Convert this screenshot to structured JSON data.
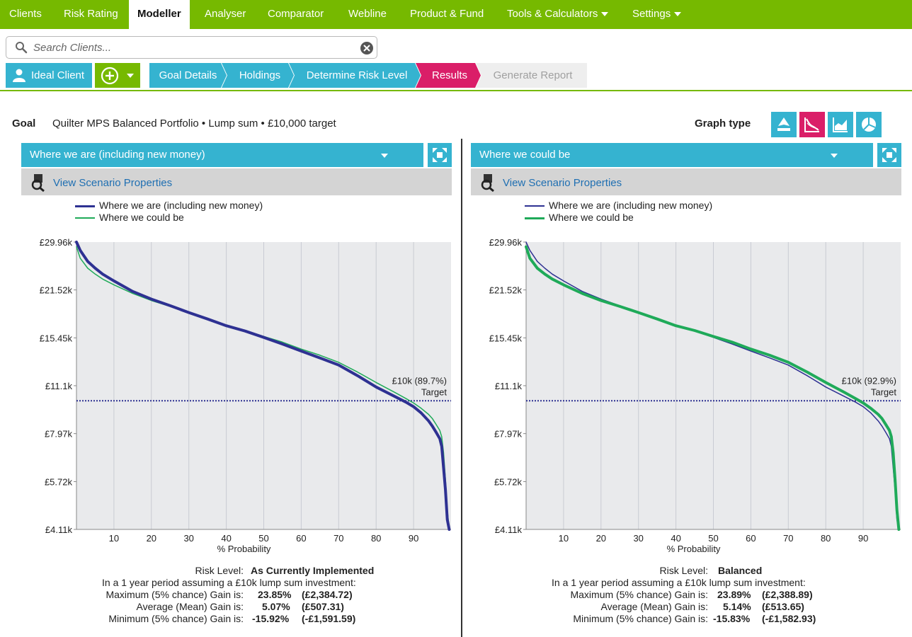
{
  "nav": {
    "items": [
      "Clients",
      "Risk Rating",
      "Modeller",
      "Analyser",
      "Comparator",
      "Webline",
      "Product & Fund",
      "Tools & Calculators",
      "Settings"
    ],
    "active": "Modeller"
  },
  "search": {
    "placeholder": "Search Clients..."
  },
  "client": {
    "name": "Ideal Client"
  },
  "steps": [
    "Goal Details",
    "Holdings",
    "Determine Risk Level",
    "Results",
    "Generate Report"
  ],
  "goal": {
    "label": "Goal",
    "text": "Quilter MPS Balanced Portfolio • Lump sum • £10,000 target"
  },
  "graph_type": {
    "label": "Graph type",
    "buttons": [
      "range-chart-icon",
      "probability-curve-icon",
      "area-chart-icon",
      "pie-chart-icon"
    ],
    "active_index": 1
  },
  "colors": {
    "nav_green": "#76b900",
    "accent_blue": "#35b3d0",
    "results_pink": "#da1e68",
    "series_navy": "#2e3192",
    "series_green": "#1faa59"
  },
  "panels": [
    {
      "title": "Where we are (including new money)",
      "props_link": "View Scenario Properties",
      "legend": [
        "Where we are (including new money)",
        "Where we could be"
      ],
      "highlight": 0,
      "target_label": "£10k (89.7%)",
      "target_word": "Target",
      "stats": {
        "risk_label": "Risk Level:",
        "risk_value": "As Currently Implemented",
        "period_text": "In a 1 year period assuming a £10k lump sum investment:",
        "rows": [
          {
            "label": "Maximum (5% chance) Gain is:",
            "pct": "23.85%",
            "amt": "(£2,384.72)"
          },
          {
            "label": "Average (Mean) Gain is:",
            "pct": "5.07%",
            "amt": "(£507.31)"
          },
          {
            "label": "Minimum (5% chance) Gain is:",
            "pct": "-15.92%",
            "amt": "(-£1,591.59)"
          }
        ]
      }
    },
    {
      "title": "Where we could be",
      "props_link": "View Scenario Properties",
      "legend": [
        "Where we are (including new money)",
        "Where we could be"
      ],
      "highlight": 1,
      "target_label": "£10k (92.9%)",
      "target_word": "Target",
      "stats": {
        "risk_label": "Risk Level:",
        "risk_value": "Balanced",
        "period_text": "In a 1 year period assuming a £10k lump sum investment:",
        "rows": [
          {
            "label": "Maximum (5% chance) Gain is:",
            "pct": "23.89%",
            "amt": "(£2,388.89)"
          },
          {
            "label": "Average (Mean) Gain is:",
            "pct": "5.14%",
            "amt": "(£513.65)"
          },
          {
            "label": "Minimum (5% chance) Gain is:",
            "pct": "-15.83%",
            "amt": "(-£1,582.93)"
          }
        ]
      }
    }
  ],
  "chart_data": [
    {
      "type": "line",
      "xlabel": "% Probability",
      "ylabel": "",
      "xlim": [
        0,
        100
      ],
      "x_ticks": [
        10,
        20,
        30,
        40,
        50,
        60,
        70,
        80,
        90
      ],
      "y_ticks": [
        "£29.96k",
        "£21.52k",
        "£15.45k",
        "£11.1k",
        "£7.97k",
        "£5.72k",
        "£4.11k"
      ],
      "y_tick_values": [
        29960,
        21520,
        15450,
        11100,
        7970,
        5720,
        4110
      ],
      "y_scale": "log",
      "target": 10000,
      "x": [
        0,
        1,
        3,
        5,
        7,
        10,
        15,
        20,
        25,
        30,
        35,
        40,
        45,
        50,
        55,
        60,
        65,
        70,
        75,
        80,
        85,
        88,
        90,
        92,
        94,
        95,
        96,
        97,
        97.5,
        98,
        98.5,
        99,
        99.5
      ],
      "series": [
        {
          "name": "Where we are (including new money)",
          "values": [
            29960,
            28300,
            26200,
            25000,
            24000,
            22900,
            21300,
            20200,
            19300,
            18400,
            17600,
            16800,
            16200,
            15500,
            14800,
            14100,
            13450,
            12800,
            11900,
            11000,
            10300,
            9900,
            9600,
            9200,
            8700,
            8400,
            8050,
            7700,
            7300,
            6300,
            5400,
            4400,
            4110
          ]
        },
        {
          "name": "Where we could be",
          "values": [
            29000,
            26800,
            25000,
            24000,
            23200,
            22300,
            21000,
            20000,
            19200,
            18400,
            17600,
            16800,
            16250,
            15600,
            15000,
            14300,
            13700,
            13050,
            12200,
            11350,
            10600,
            10150,
            9850,
            9500,
            9100,
            8850,
            8500,
            8150,
            7800,
            7000,
            5800,
            4700,
            4110
          ]
        }
      ]
    },
    {
      "type": "line",
      "xlabel": "% Probability",
      "ylabel": "",
      "xlim": [
        0,
        100
      ],
      "x_ticks": [
        10,
        20,
        30,
        40,
        50,
        60,
        70,
        80,
        90
      ],
      "y_ticks": [
        "£29.96k",
        "£21.52k",
        "£15.45k",
        "£11.1k",
        "£7.97k",
        "£5.72k",
        "£4.11k"
      ],
      "y_tick_values": [
        29960,
        21520,
        15450,
        11100,
        7970,
        5720,
        4110
      ],
      "y_scale": "log",
      "target": 10000,
      "x": [
        0,
        1,
        3,
        5,
        7,
        10,
        15,
        20,
        25,
        30,
        35,
        40,
        45,
        50,
        55,
        60,
        65,
        70,
        75,
        80,
        85,
        88,
        90,
        92,
        94,
        95,
        96,
        97,
        97.5,
        98,
        98.5,
        99,
        99.5
      ],
      "series": [
        {
          "name": "Where we are (including new money)",
          "values": [
            29960,
            28300,
            26200,
            25000,
            24000,
            22900,
            21300,
            20200,
            19300,
            18400,
            17600,
            16800,
            16200,
            15500,
            14800,
            14100,
            13450,
            12800,
            11900,
            11000,
            10300,
            9900,
            9600,
            9200,
            8700,
            8400,
            8050,
            7700,
            7300,
            6300,
            5400,
            4400,
            4110
          ]
        },
        {
          "name": "Where we could be",
          "values": [
            29000,
            26800,
            25000,
            24000,
            23200,
            22300,
            21000,
            20000,
            19200,
            18400,
            17600,
            16800,
            16250,
            15600,
            15000,
            14300,
            13700,
            13050,
            12200,
            11350,
            10600,
            10150,
            9850,
            9500,
            9100,
            8850,
            8500,
            8150,
            7800,
            7000,
            5800,
            4700,
            4110
          ]
        }
      ]
    }
  ]
}
